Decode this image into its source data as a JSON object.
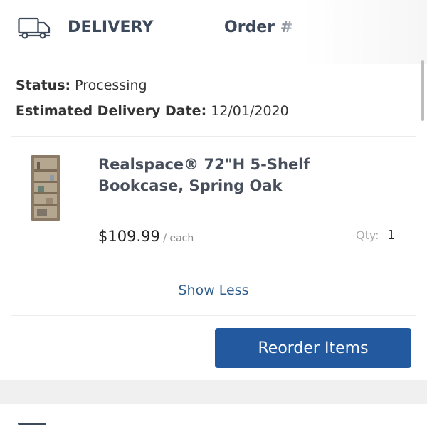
{
  "header": {
    "title": "DELIVERY",
    "order_label": "Order #"
  },
  "status": {
    "label": "Status:",
    "value": " Processing"
  },
  "eta": {
    "label": "Estimated Delivery Date:",
    "value": " 12/01/2020"
  },
  "item": {
    "title": "Realspace® 72\"H 5-Shelf Bookcase, Spring Oak",
    "price": "$109.99",
    "unit": " / each",
    "qty_label": "Qty:",
    "qty_value": "1"
  },
  "actions": {
    "show_less": "Show Less",
    "reorder": "Reorder Items"
  },
  "icons": {
    "truck": "truck-icon",
    "product": "bookcase-thumbnail"
  },
  "colors": {
    "primary_button": "#23599e",
    "link": "#2f5e8e",
    "heading": "#3d4a5c"
  }
}
